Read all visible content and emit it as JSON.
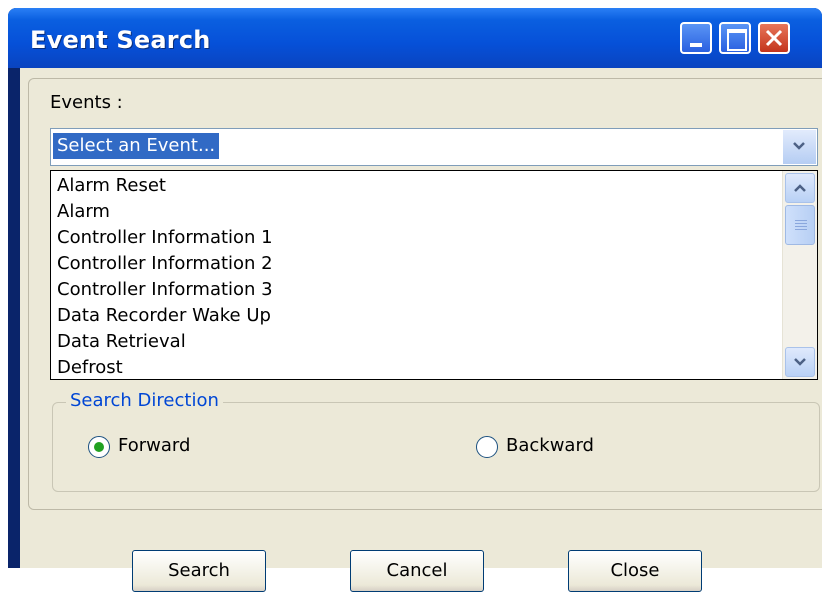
{
  "window": {
    "title": "Event Search"
  },
  "events": {
    "label": "Events :",
    "combo_value": "Select an Event...",
    "items": [
      "Alarm Reset",
      "Alarm",
      "Controller Information 1",
      "Controller Information 2",
      "Controller Information 3",
      "Data Recorder Wake Up",
      "Data Retrieval",
      "Defrost"
    ]
  },
  "search_direction": {
    "legend": "Search Direction",
    "forward_label": "Forward",
    "backward_label": "Backward",
    "selected": "Forward"
  },
  "buttons": {
    "search": "Search",
    "cancel": "Cancel",
    "close": "Close"
  },
  "colors": {
    "titlebar": "#0a5fe0",
    "selection": "#316ac5",
    "legend_text": "#0046d5",
    "dialog_bg": "#ece9d8"
  }
}
